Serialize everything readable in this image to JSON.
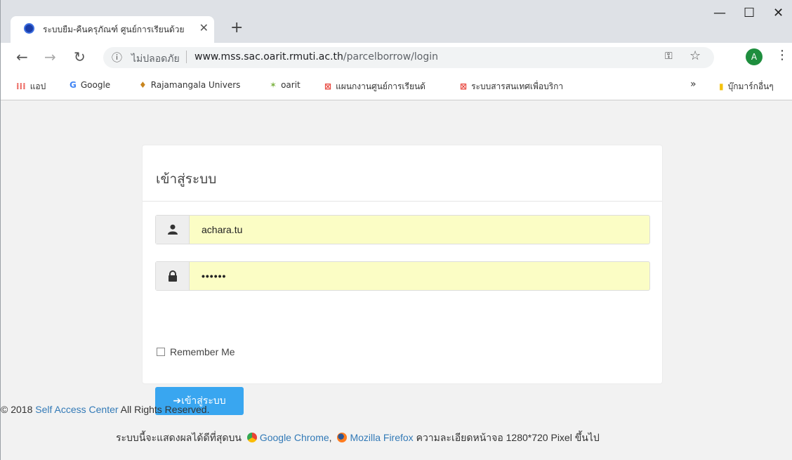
{
  "browser": {
    "tab_title": "ระบบยืม-คืนครุภัณฑ์ ศูนย์การเรียนด้วย",
    "tab_close": "✕",
    "new_tab": "+",
    "security_label": "ไม่ปลอดภัย",
    "url_host": "www.mss.sac.oarit.rmuti.ac.th",
    "url_path": "/parcelborrow/login",
    "avatar_letter": "A"
  },
  "bookmarks": {
    "apps": "แอป",
    "google": "Google",
    "rajamangala": "Rajamangala Univers",
    "oarit": "oarit",
    "plan": "แผนกงานศูนย์การเรียนด้",
    "system": "ระบบสารสนเทศเพื่อบริกา",
    "more": "»",
    "other": "บุ๊กมาร์กอื่นๆ"
  },
  "login": {
    "heading": "เข้าสู่ระบบ",
    "username_value": "achara.tu",
    "password_value": "••••••",
    "remember_label": "Remember Me",
    "submit_label": "เข้าสู่ระบบ"
  },
  "footer": {
    "copyright_prefix": "© 2018 ",
    "copyright_link": "Self Access Center",
    "copyright_suffix": " All Rights Reserved.",
    "browser_note_prefix": "ระบบนี้จะแสดงผลได้ดีที่สุดบน",
    "chrome_link": "Google Chrome",
    "firefox_link": "Mozilla Firefox",
    "browser_note_suffix": "ความละเอียดหน้าจอ 1280*720 Pixel ขึ้นไป"
  },
  "colors": {
    "primary_button": "#39a6f0",
    "autofill_bg": "#fbfdc5",
    "link": "#337ab7"
  }
}
